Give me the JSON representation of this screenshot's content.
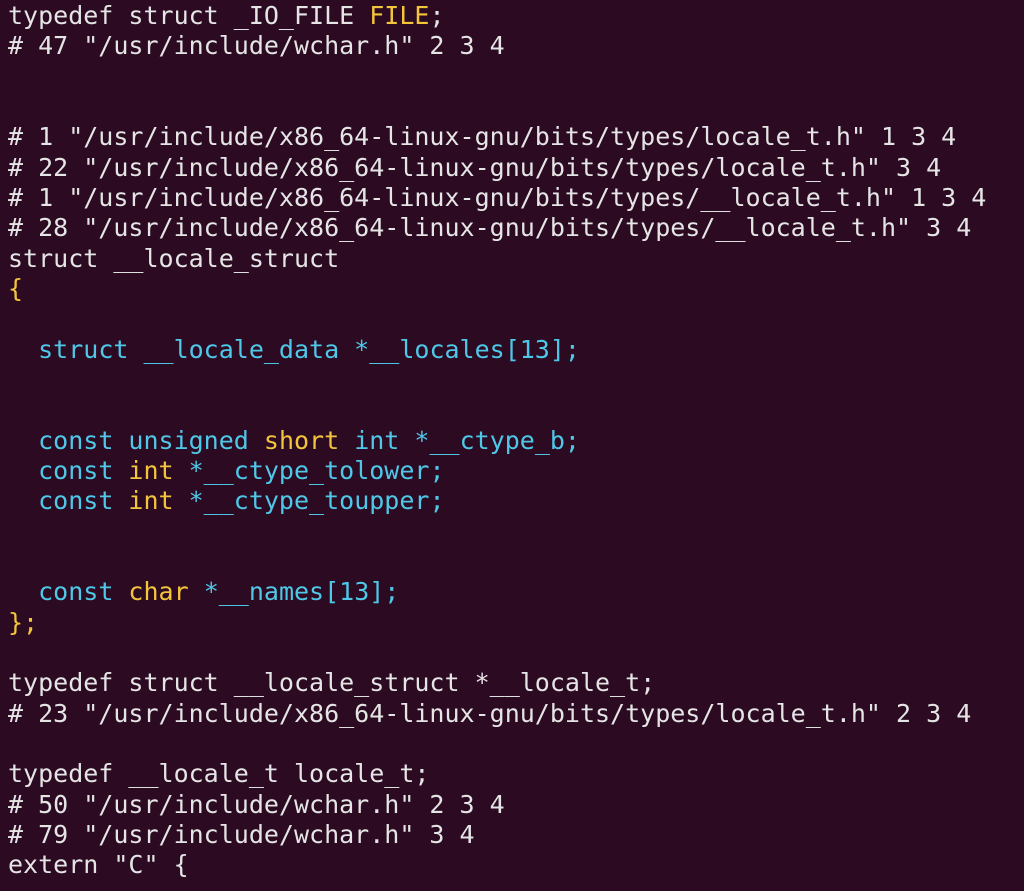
{
  "colors": {
    "background": "#2b0a22",
    "plain": "#e5e5e5",
    "keyword_cyan": "#4fc8e8",
    "type_yellow": "#f2c53b",
    "preprocessor": "#e5e5e5"
  },
  "lines": [
    [
      [
        "plain",
        "typedef struct _IO_FILE "
      ],
      [
        "yellow",
        "FILE"
      ],
      [
        "plain",
        ";"
      ]
    ],
    [
      [
        "plain",
        "# 47 \"/usr/include/wchar.h\" 2 3 4"
      ]
    ],
    [],
    [],
    [
      [
        "plain",
        "# 1 \"/usr/include/x86_64-linux-gnu/bits/types/locale_t.h\" 1 3 4"
      ]
    ],
    [
      [
        "plain",
        "# 22 \"/usr/include/x86_64-linux-gnu/bits/types/locale_t.h\" 3 4"
      ]
    ],
    [
      [
        "plain",
        "# 1 \"/usr/include/x86_64-linux-gnu/bits/types/__locale_t.h\" 1 3 4"
      ]
    ],
    [
      [
        "plain",
        "# 28 \"/usr/include/x86_64-linux-gnu/bits/types/__locale_t.h\" 3 4"
      ]
    ],
    [
      [
        "plain",
        "struct __locale_struct"
      ]
    ],
    [
      [
        "yellow",
        "{"
      ]
    ],
    [],
    [
      [
        "plain",
        "  "
      ],
      [
        "cyan",
        "struct __locale_data *__locales[13];"
      ]
    ],
    [],
    [],
    [
      [
        "plain",
        "  "
      ],
      [
        "cyan",
        "const unsigned "
      ],
      [
        "yellow",
        "short"
      ],
      [
        "cyan",
        " int *__ctype_b;"
      ]
    ],
    [
      [
        "plain",
        "  "
      ],
      [
        "cyan",
        "const "
      ],
      [
        "yellow",
        "int"
      ],
      [
        "cyan",
        " *__ctype_tolower;"
      ]
    ],
    [
      [
        "plain",
        "  "
      ],
      [
        "cyan",
        "const "
      ],
      [
        "yellow",
        "int"
      ],
      [
        "cyan",
        " *__ctype_toupper;"
      ]
    ],
    [],
    [],
    [
      [
        "plain",
        "  "
      ],
      [
        "cyan",
        "const "
      ],
      [
        "yellow",
        "char"
      ],
      [
        "cyan",
        " *__names[13];"
      ]
    ],
    [
      [
        "yellow",
        "};"
      ]
    ],
    [],
    [
      [
        "plain",
        "typedef struct __locale_struct *__locale_t;"
      ]
    ],
    [
      [
        "plain",
        "# 23 \"/usr/include/x86_64-linux-gnu/bits/types/locale_t.h\" 2 3 4"
      ]
    ],
    [],
    [
      [
        "plain",
        "typedef __locale_t locale_t;"
      ]
    ],
    [
      [
        "plain",
        "# 50 \"/usr/include/wchar.h\" 2 3 4"
      ]
    ],
    [
      [
        "plain",
        "# 79 \"/usr/include/wchar.h\" 3 4"
      ]
    ],
    [
      [
        "plain",
        "extern \"C\" {"
      ]
    ]
  ]
}
